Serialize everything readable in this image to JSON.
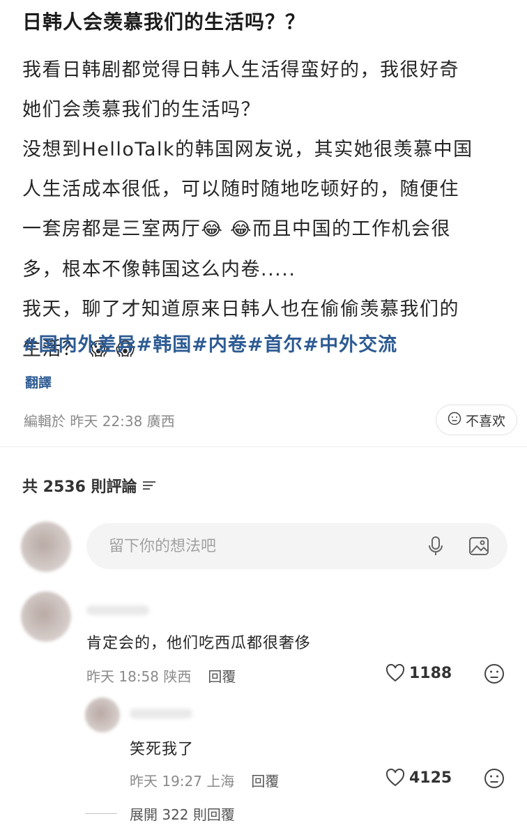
{
  "post": {
    "title": "日韩人会羡慕我们的生活吗？？",
    "body_lines": [
      "我看日韩剧都觉得日韩人生活得蛮好的，我很好奇",
      "她们会羡慕我们的生活吗？",
      "没想到HelloTalk的韩国网友说，其实她很羡慕中国",
      "人生活成本很低，可以随时随地吃顿好的，随便住",
      "一套房都是三室两厅",
      "而且中国的工作机会很",
      "多，根本不像韩国这么内卷.....",
      "我天，聊了才知道原来日韩人也在偷偷羡慕我们的",
      "生活？"
    ],
    "emoji_laugh": "😂 😂",
    "emoji_scream": "😱 😱",
    "hashtags": "#国内外差异#韩国#内卷#首尔#中外交流",
    "translate_label": "翻譯",
    "edited_meta": "編輯於 昨天 22:38 廣西",
    "dislike_label": "不喜欢"
  },
  "comments_header": {
    "count_label": "共 2536 則評論"
  },
  "input": {
    "placeholder": "留下你的想法吧"
  },
  "comments": [
    {
      "text": "肯定会的，他们吃西瓜都很奢侈",
      "time": "昨天 18:58",
      "location": "陕西",
      "reply_label": "回覆",
      "likes": "1188"
    },
    {
      "text": "笑死我了",
      "time": "昨天 19:27",
      "location": "上海",
      "reply_label": "回覆",
      "likes": "4125"
    }
  ],
  "expand_replies": "展開 322 則回覆",
  "colors": {
    "hashtag": "#2d5b93",
    "meta_gray": "#8a8a8a",
    "input_bg": "#f4f4f4"
  },
  "icons": [
    "mic-icon",
    "image-icon",
    "heart-icon",
    "neutral-face-icon",
    "sort-icon"
  ]
}
